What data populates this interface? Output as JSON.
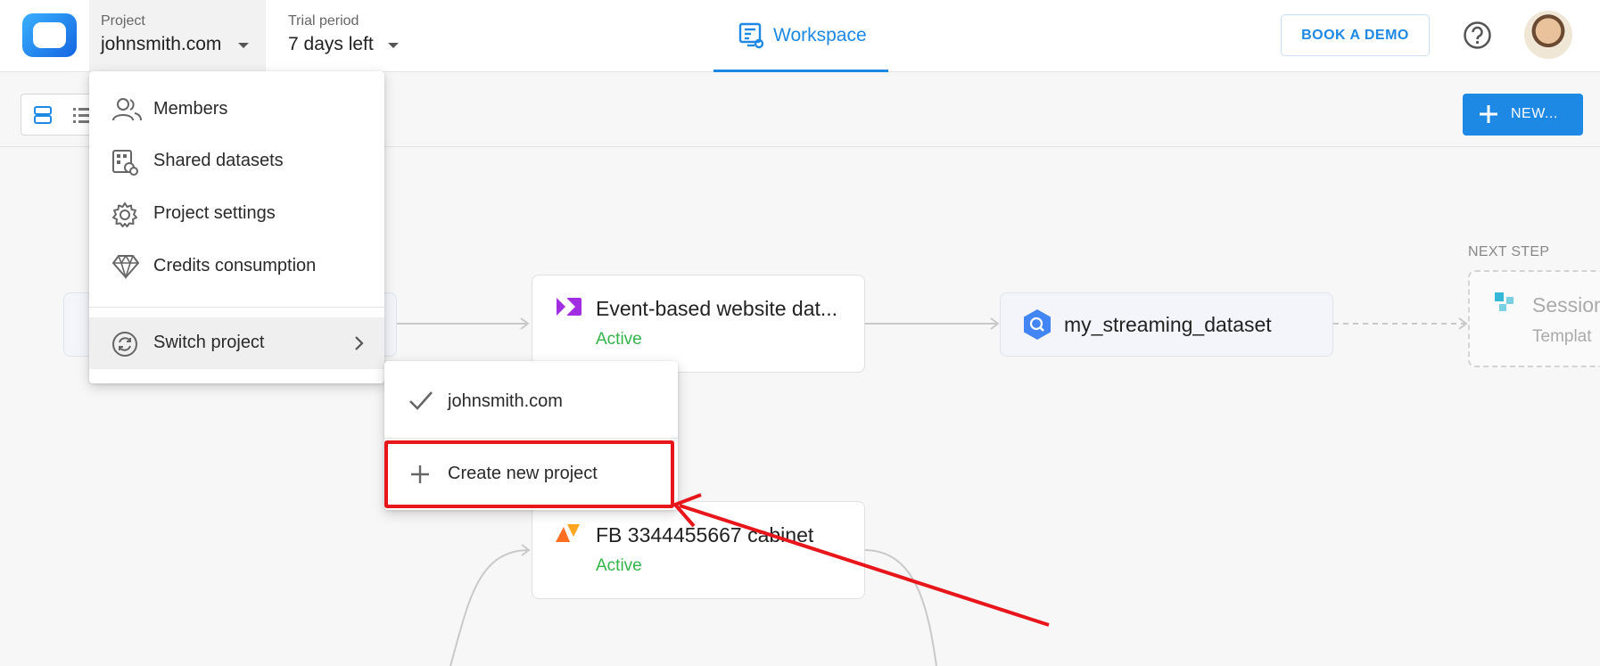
{
  "header": {
    "project_label": "Project",
    "project_value": "johnsmith.com",
    "trial_label": "Trial period",
    "trial_value": "7 days left",
    "workspace_tab": "Workspace",
    "book_demo": "BOOK A DEMO"
  },
  "toolbar": {
    "new_button": "NEW..."
  },
  "project_menu": {
    "items": [
      {
        "label": "Members",
        "icon": "members-icon"
      },
      {
        "label": "Shared datasets",
        "icon": "shared-datasets-icon"
      },
      {
        "label": "Project settings",
        "icon": "gear-icon"
      },
      {
        "label": "Credits consumption",
        "icon": "diamond-icon"
      }
    ],
    "switch_project": "Switch project"
  },
  "switch_submenu": {
    "current_project": "johnsmith.com",
    "create_new": "Create new project"
  },
  "canvas": {
    "nodes": [
      {
        "name": "Event-based website dat...",
        "status": "Active"
      },
      {
        "name": "FB 3344455667 cabinet",
        "status": "Active"
      }
    ],
    "dataset": "my_streaming_dataset",
    "next_step_label": "NEXT STEP",
    "next_step_name": "Session",
    "next_step_sub": "Templat"
  },
  "colors": {
    "accent": "#1e88e5",
    "active_status": "#34b34a",
    "annotation": "#e8161b"
  }
}
